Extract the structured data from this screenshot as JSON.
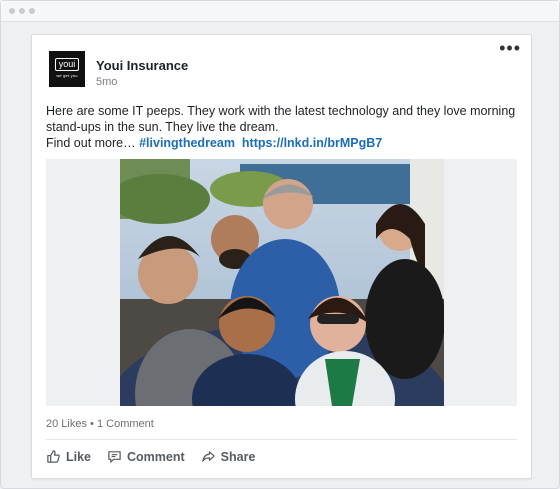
{
  "post": {
    "author": "Youi Insurance",
    "time": "5mo",
    "logo_text": "youi",
    "logo_tagline": "we get you",
    "text_main": "Here are some IT peeps. They work with the latest technology and they love morning stand-ups in the sun. They live the dream.",
    "text_prefix": "Find out more… ",
    "hashtag": "#livingthedream",
    "link": "https://lnkd.in/brMPgB7"
  },
  "social": {
    "likes": "20 Likes",
    "separator": " • ",
    "comments": "1 Comment"
  },
  "actions": {
    "like": "Like",
    "comment": "Comment",
    "share": "Share"
  },
  "menu": {
    "more": "•••"
  },
  "colors": {
    "accent": "#1a6dbb",
    "text": "#1d2226",
    "muted": "#6b7075"
  },
  "icons": [
    "more-icon",
    "like-icon",
    "comment-icon",
    "share-icon"
  ]
}
